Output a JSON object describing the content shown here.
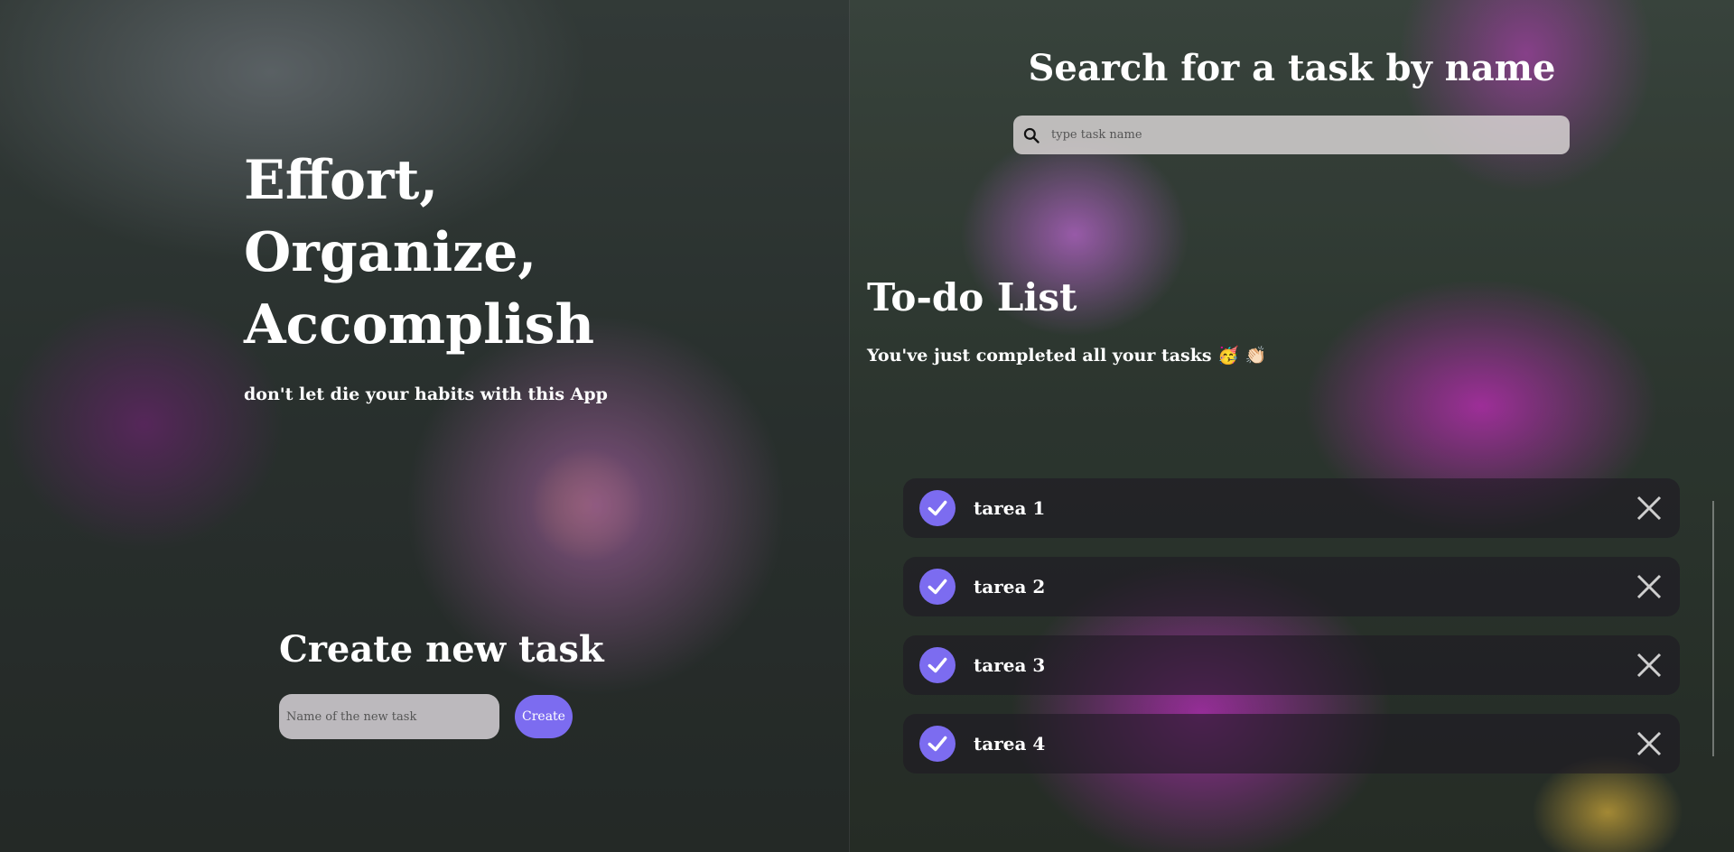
{
  "hero": {
    "line1": "Effort,",
    "line2": "Organize,",
    "line3": "Accomplish",
    "tagline": "don't let die your habits with this App"
  },
  "create": {
    "title": "Create new task",
    "input_placeholder": "Name of the new task",
    "button_label": "Create"
  },
  "search": {
    "title": "Search for a task by name",
    "placeholder": "type task name",
    "icon": "search-icon"
  },
  "todo": {
    "title": "To-do List",
    "status": "You've just completed all your tasks 🥳 👏🏻",
    "tasks": [
      {
        "label": "tarea 1",
        "completed": true
      },
      {
        "label": "tarea 2",
        "completed": true
      },
      {
        "label": "tarea 3",
        "completed": true
      },
      {
        "label": "tarea 4",
        "completed": true
      }
    ]
  },
  "colors": {
    "accent": "#7c6cf0"
  }
}
